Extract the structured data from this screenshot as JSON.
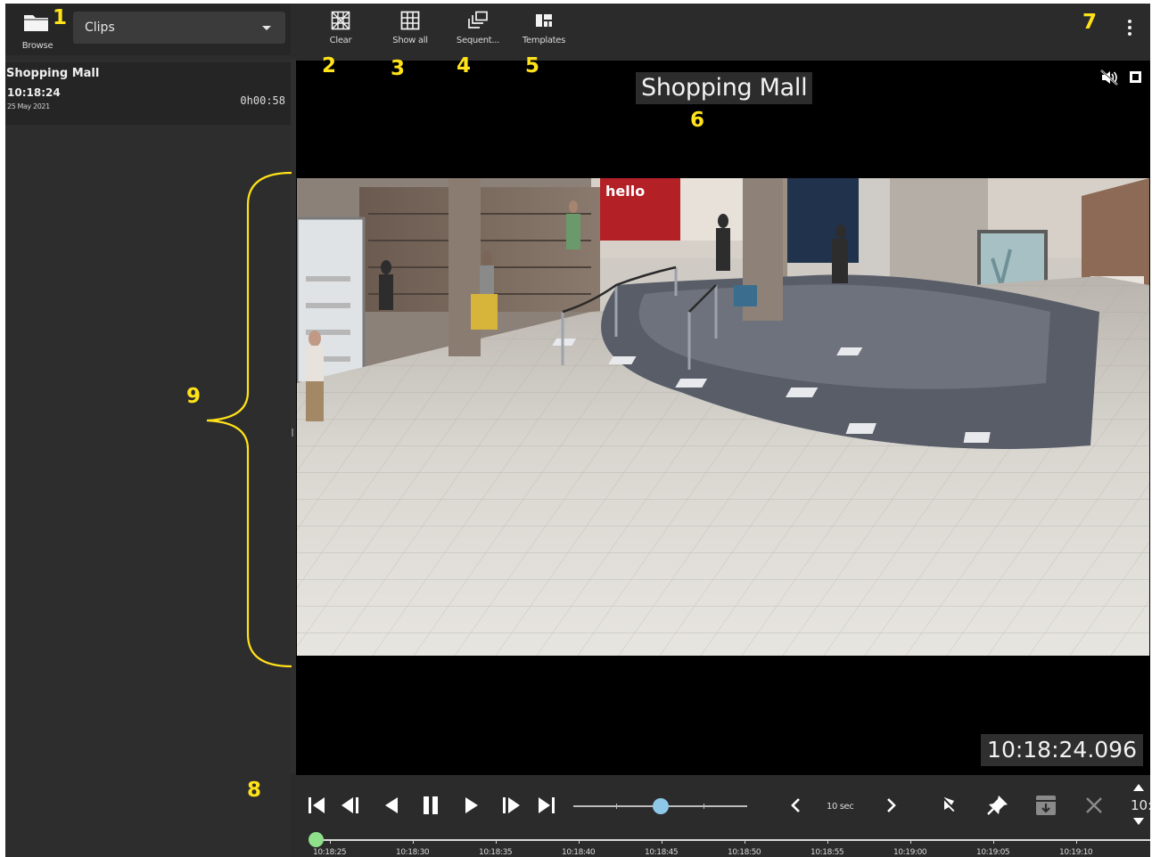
{
  "sidebar": {
    "browse_label": "Browse",
    "source_select": {
      "selected": "Clips"
    },
    "clips": [
      {
        "title": "Shopping Mall",
        "time": "10:18:24",
        "date": "25 May 2021",
        "duration": "0h00:58"
      }
    ]
  },
  "toolbar": {
    "buttons": [
      {
        "label": "Clear",
        "icon": "clear-grid-icon"
      },
      {
        "label": "Show all",
        "icon": "grid-icon"
      },
      {
        "label": "Sequent...",
        "icon": "sequence-icon"
      },
      {
        "label": "Templates",
        "icon": "templates-icon"
      }
    ],
    "more_icon": "more-vertical-icon"
  },
  "viewer": {
    "camera_title": "Shopping Mall",
    "timestamp": "10:18:24.096",
    "mute_icon": "mute-icon",
    "stop_icon": "stop-icon"
  },
  "playback": {
    "buttons": [
      "skip-to-start-icon",
      "step-back-icon",
      "reverse-play-icon",
      "pause-icon",
      "play-icon",
      "step-forward-icon",
      "skip-to-end-icon"
    ],
    "speed_level": 0.5,
    "step_label": "10 sec",
    "actions": [
      "prev-step-icon",
      "next-step-icon",
      "clear-bookmark-icon",
      "bookmark-icon",
      "archive-icon",
      "close-icon"
    ],
    "jump_hour_text": "10:"
  },
  "timeline": {
    "ticks": [
      "10:18:25",
      "10:18:30",
      "10:18:35",
      "10:18:40",
      "10:18:45",
      "10:18:50",
      "10:18:55",
      "10:19:00",
      "10:19:05",
      "10:19:10"
    ]
  },
  "annotations": [
    "1",
    "2",
    "3",
    "4",
    "5",
    "6",
    "7",
    "8",
    "9"
  ],
  "colors": {
    "annotation": "#ffe21a",
    "playhead": "#8fe08a",
    "speed_thumb": "#8ec8e8",
    "background": "#2b2b2b"
  }
}
